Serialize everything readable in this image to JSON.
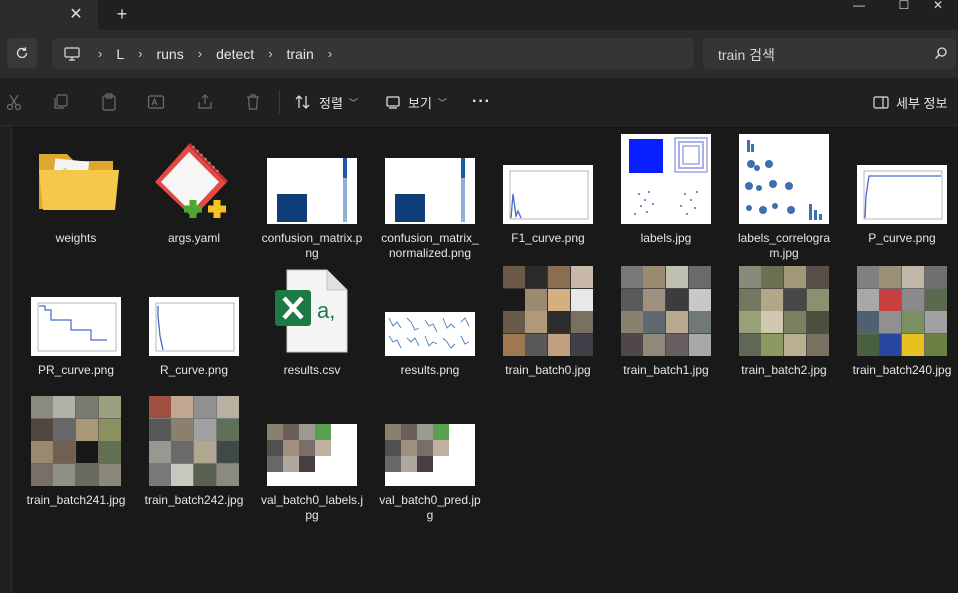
{
  "window": {
    "tab_close": "✕",
    "new_tab": "+",
    "minimize": "—",
    "maximize": "☐",
    "close": "✕"
  },
  "nav": {
    "refresh_icon": "refresh-icon",
    "breadcrumb": [
      "L",
      "runs",
      "detect",
      "train"
    ],
    "search_placeholder": "train 검색"
  },
  "toolbar": {
    "sort_label": "정렬",
    "view_label": "보기",
    "more_label": "···",
    "details_label": "세부 정보"
  },
  "files": [
    {
      "name": "weights",
      "type": "folder"
    },
    {
      "name": "args.yaml",
      "type": "yaml"
    },
    {
      "name": "confusion_matrix.png",
      "type": "cm"
    },
    {
      "name": "confusion_matrix_normalized.png",
      "type": "cm"
    },
    {
      "name": "F1_curve.png",
      "type": "curve"
    },
    {
      "name": "labels.jpg",
      "type": "labels"
    },
    {
      "name": "labels_correlogram.jpg",
      "type": "correlogram"
    },
    {
      "name": "P_curve.png",
      "type": "curve"
    },
    {
      "name": "PR_curve.png",
      "type": "pr"
    },
    {
      "name": "R_curve.png",
      "type": "curve"
    },
    {
      "name": "results.csv",
      "type": "csv"
    },
    {
      "name": "results.png",
      "type": "results"
    },
    {
      "name": "train_batch0.jpg",
      "type": "batch"
    },
    {
      "name": "train_batch1.jpg",
      "type": "batch"
    },
    {
      "name": "train_batch2.jpg",
      "type": "batch"
    },
    {
      "name": "train_batch240.jpg",
      "type": "batch"
    },
    {
      "name": "train_batch241.jpg",
      "type": "batch"
    },
    {
      "name": "train_batch242.jpg",
      "type": "batch"
    },
    {
      "name": "val_batch0_labels.jpg",
      "type": "val"
    },
    {
      "name": "val_batch0_pred.jpg",
      "type": "val"
    }
  ]
}
